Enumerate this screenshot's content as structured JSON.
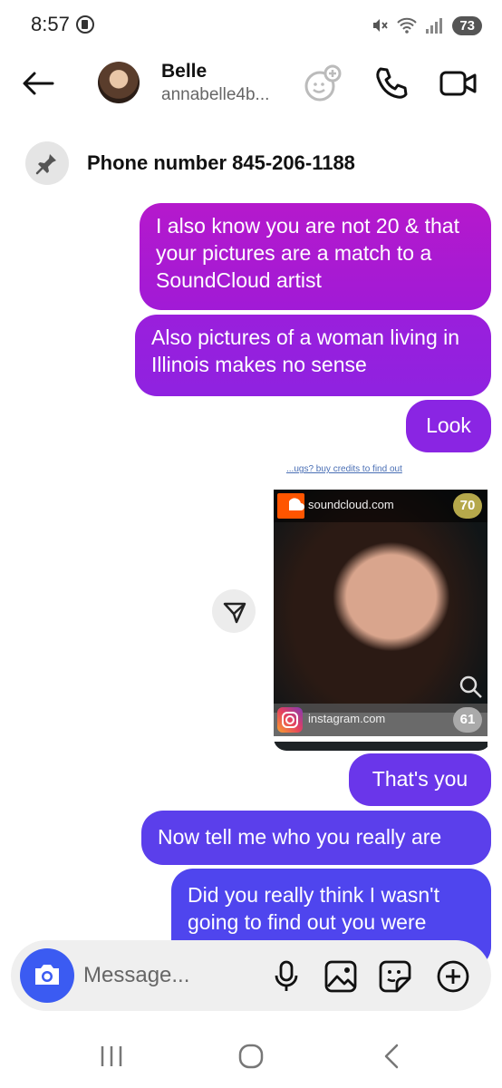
{
  "status_bar": {
    "time": "8:57",
    "battery": "73"
  },
  "header": {
    "name": "Belle",
    "handle": "annabelle4b..."
  },
  "pinned": {
    "text": "Phone number 845-206-1188"
  },
  "messages": [
    {
      "text": "I also know you are not 20 & that your pictures are a match to a SoundCloud artist"
    },
    {
      "text": "Also pictures of a woman living in Illinois makes no sense"
    },
    {
      "text": "Look"
    },
    {
      "text": "That's you"
    },
    {
      "text": "Now tell me who you really are"
    },
    {
      "text": "Did you really think I wasn't going to find out you were"
    }
  ],
  "image_message": {
    "caption_top": "...ugs? buy credits to find out",
    "source1": {
      "site": "soundcloud.com",
      "score": "70"
    },
    "source2": {
      "site": "instagram.com",
      "score": "61"
    }
  },
  "composer": {
    "placeholder": "Message..."
  },
  "colors": {
    "accent": "#3b5bf2",
    "bubble_top": "#b519cc",
    "bubble_bottom": "#4f45ee"
  },
  "icons": [
    "back-arrow-icon",
    "add-person-icon",
    "phone-icon",
    "video-icon",
    "pin-icon",
    "share-icon",
    "camera-icon",
    "mic-icon",
    "gallery-icon",
    "sticker-icon",
    "plus-icon",
    "recents-icon",
    "home-icon",
    "nav-back-icon"
  ]
}
